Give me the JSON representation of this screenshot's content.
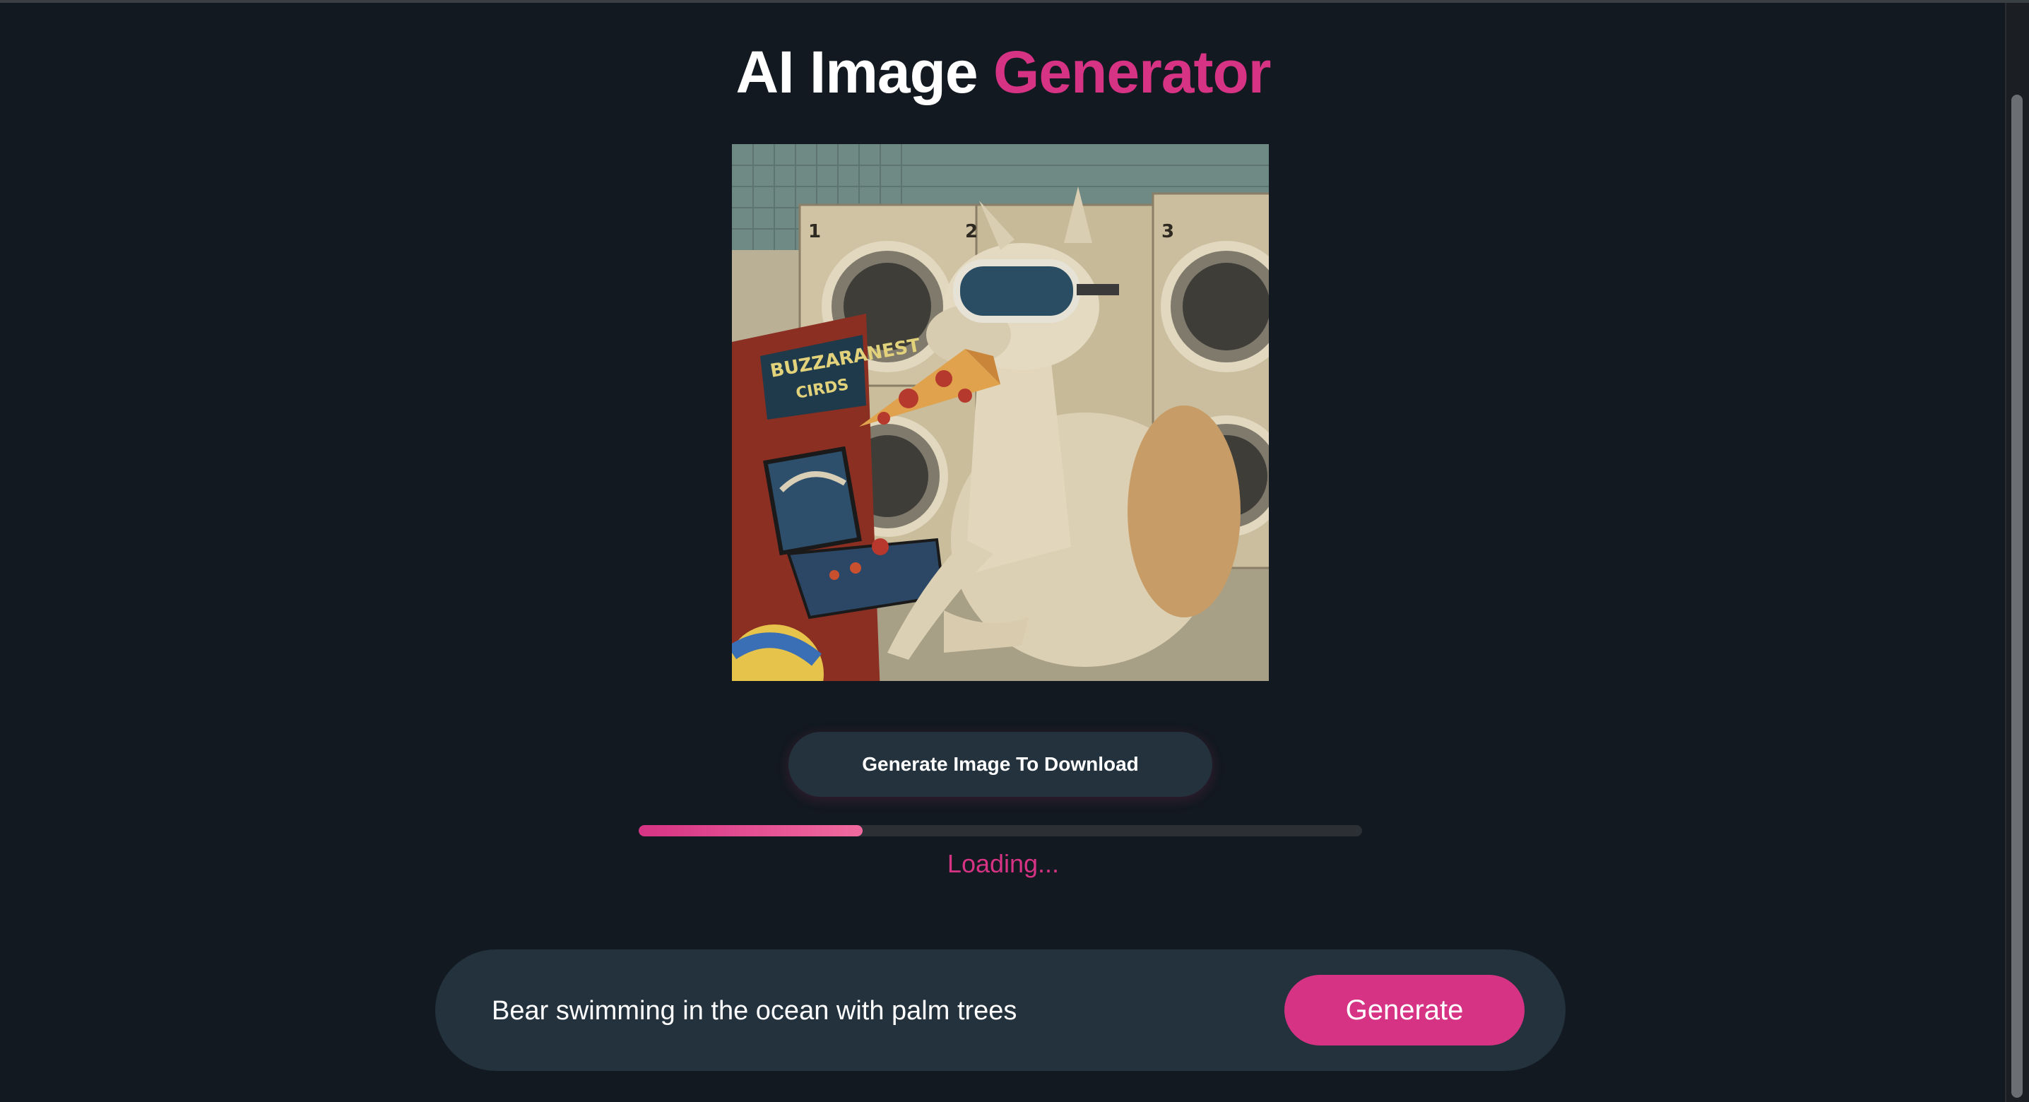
{
  "header": {
    "title_part1": "AI Image",
    "title_part2": "Generator"
  },
  "image": {
    "alt": "Llama wearing ski goggles eating pizza at an arcade machine in a laundromat",
    "arcade_marquee_line1": "BUZZARANEST",
    "arcade_marquee_line2": "CIRDS",
    "washer_numbers": [
      "1",
      "2",
      "3"
    ]
  },
  "actions": {
    "download_label": "Generate Image To Download"
  },
  "progress": {
    "fraction": 0.31,
    "status_text": "Loading..."
  },
  "prompt": {
    "value": "Bear swimming in the ocean with palm trees",
    "generate_label": "Generate"
  },
  "colors": {
    "accent": "#d63384",
    "background": "#121920",
    "panel": "#23323d"
  }
}
